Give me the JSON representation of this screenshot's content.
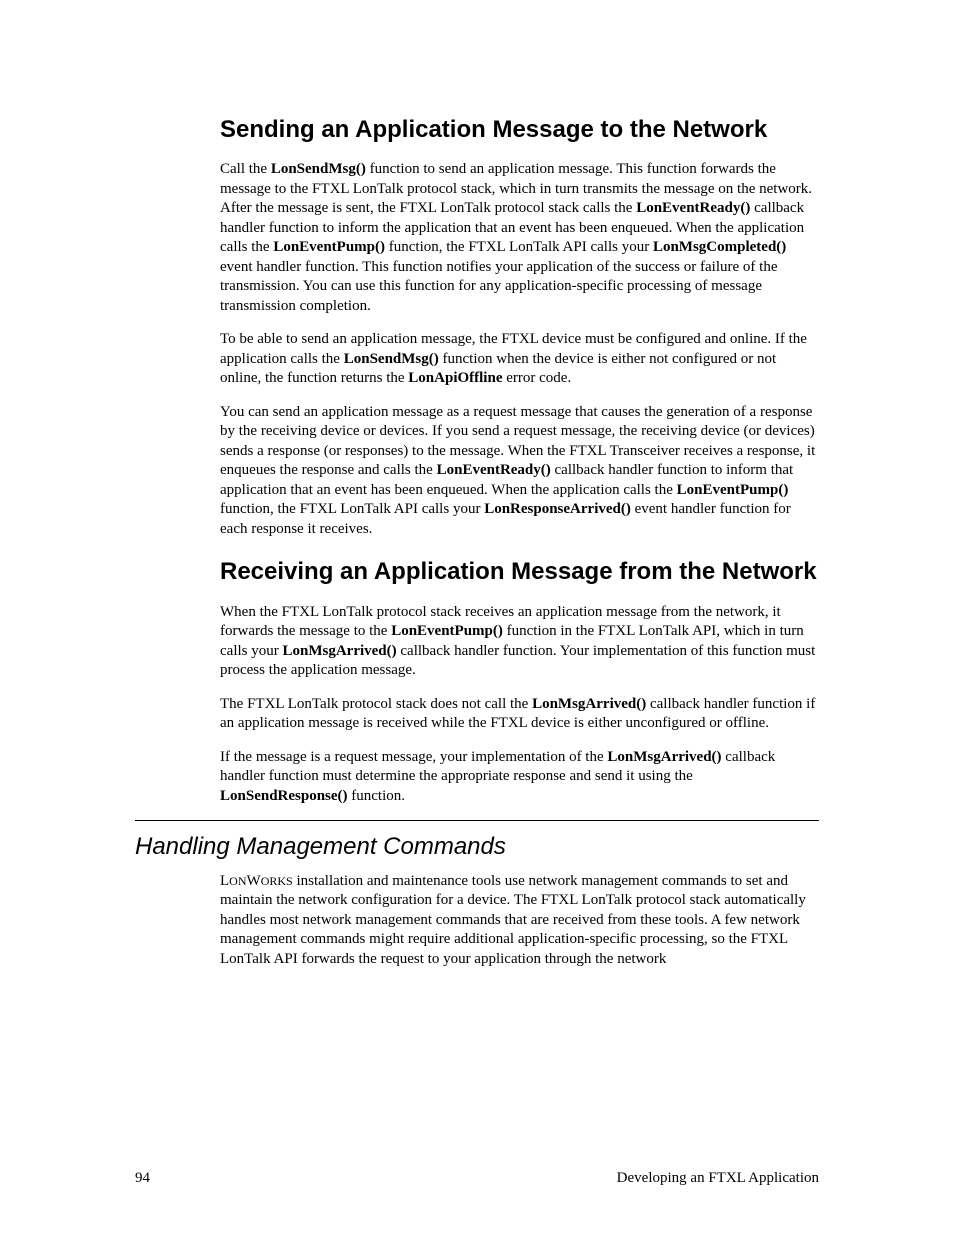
{
  "headings": {
    "h1": "Sending an Application Message to the Network",
    "h2": "Receiving an Application Message from the Network",
    "h3": "Handling Management Commands"
  },
  "p1": {
    "t1": "Call the ",
    "b1": "LonSendMsg()",
    "t2": " function to send an application message.  This function forwards the message to the FTXL LonTalk protocol stack, which in turn transmits the message on the network.  After the message is sent, the FTXL LonTalk protocol stack calls the ",
    "b2": "LonEventReady()",
    "t3": " callback handler function to inform the application that an event has been enqueued.  When the application calls the ",
    "b3": "LonEventPump()",
    "t4": " function, the FTXL LonTalk API calls your ",
    "b4": "LonMsgCompleted()",
    "t5": " event handler function.  This function notifies your application of the success or failure of the transmission.  You can use this function for any application-specific processing of message transmission completion."
  },
  "p2": {
    "t1": "To be able to send an application message, the FTXL device must be configured and online.  If the application calls the ",
    "b1": "LonSendMsg()",
    "t2": " function when the device is either not configured or not online, the function returns the ",
    "b2": "LonApiOffline",
    "t3": " error code."
  },
  "p3": {
    "t1": "You can send an application message as a request message that causes the generation of a response by the receiving device or devices.  If you send a request message, the receiving device (or devices) sends a response (or responses) to the message.  When the FTXL Transceiver receives a response, it enqueues the response and calls the ",
    "b1": "LonEventReady()",
    "t2": " callback handler function to inform that application that an event has been enqueued.  When the application calls the ",
    "b2": "LonEventPump()",
    "t3": " function, the FTXL LonTalk API calls your ",
    "b3": "LonResponseArrived()",
    "t4": " event handler function for each response it receives."
  },
  "p4": {
    "t1": "When the FTXL LonTalk protocol stack receives an application message from the network, it forwards the message to the ",
    "b1": "LonEventPump()",
    "t2": " function in the FTXL LonTalk API, which in turn calls your ",
    "b2": "LonMsgArrived()",
    "t3": " callback handler function.  Your implementation of this function must process the application message."
  },
  "p5": {
    "t1": "The FTXL LonTalk protocol stack does not call the ",
    "b1": "LonMsgArrived()",
    "t2": " callback handler function if an application message is received while the FTXL device is either unconfigured or offline."
  },
  "p6": {
    "t1": "If the message is a request message, your implementation of the ",
    "b1": "LonMsgArrived()",
    "t2": " callback handler function must determine the appropriate response and send it using the ",
    "b2": "LonSendResponse()",
    "t3": " function."
  },
  "p7": {
    "t0a": "L",
    "t0b": "ON",
    "t0c": "W",
    "t0d": "ORKS",
    "t1": " installation and maintenance tools use network management commands to set and maintain the network configuration for a device.  The FTXL LonTalk protocol stack automatically handles most network management commands that are received from these tools.  A few network management commands might require additional application-specific processing, so the FTXL LonTalk API forwards the request to your application through the network"
  },
  "footer": {
    "page": "94",
    "title": "Developing an FTXL Application"
  }
}
